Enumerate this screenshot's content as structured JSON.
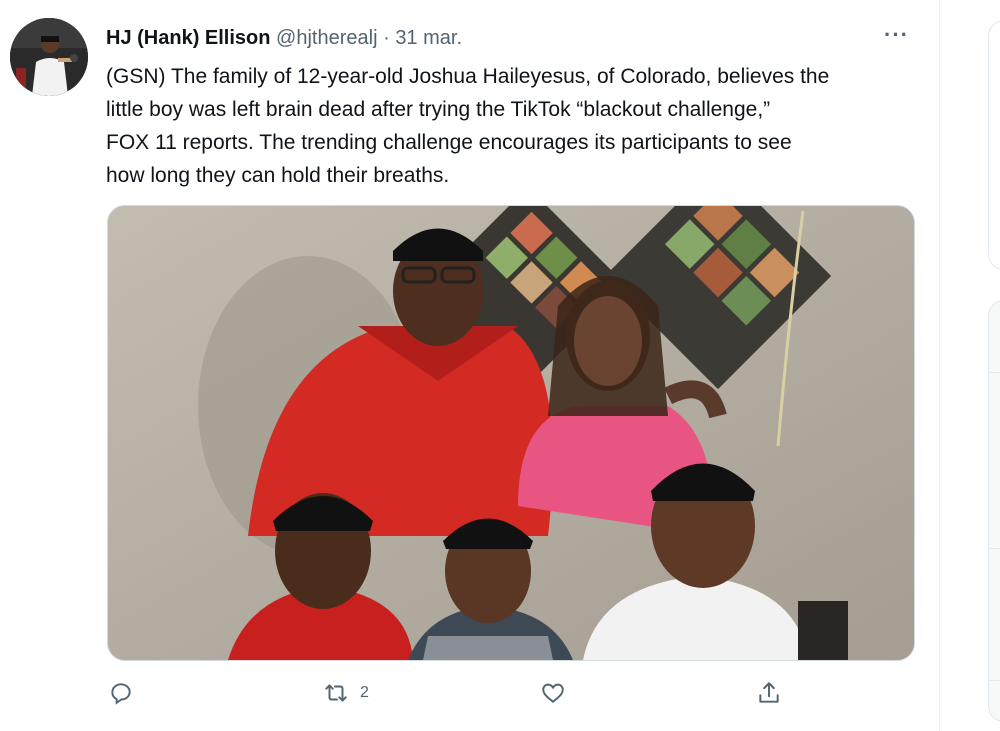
{
  "tweet": {
    "display_name": "HJ (Hank) Ellison",
    "handle": "@hjtherealj",
    "separator": "·",
    "date": "31 mar.",
    "more_label": "···",
    "text": "(GSN) The family of 12-year-old Joshua Haileyesus, of Colorado, believes the\nlittle boy was left brain dead after trying the TikTok “blackout challenge,”\nFOX 11 reports. The trending challenge encourages its participants to see\nhow long they can hold their breaths."
  },
  "actions": {
    "reply": {
      "icon": "reply-icon",
      "count": ""
    },
    "retweet": {
      "icon": "retweet-icon",
      "count": "2"
    },
    "like": {
      "icon": "heart-icon",
      "count": ""
    },
    "share": {
      "icon": "share-icon",
      "count": ""
    }
  },
  "colors": {
    "text": "#0f1419",
    "secondary": "#536471",
    "border": "#cfd9de"
  }
}
